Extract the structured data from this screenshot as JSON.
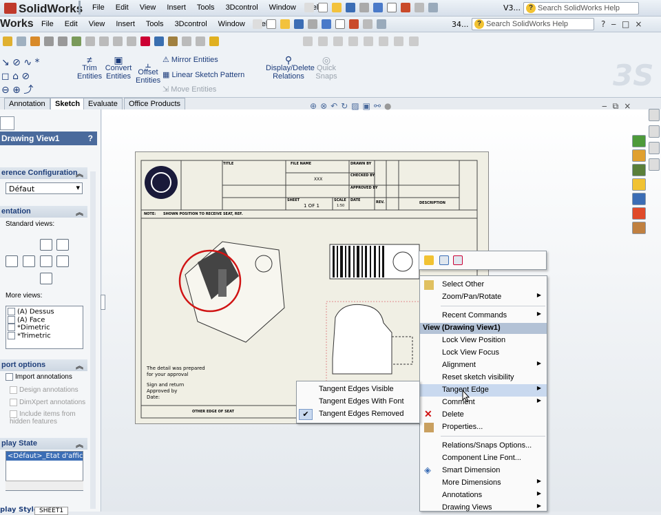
{
  "app": {
    "logo": "SolidWorks",
    "logo_inner": "Works",
    "version_label": "V3...",
    "version_label_inner": "34..."
  },
  "menu": [
    "File",
    "Edit",
    "View",
    "Insert",
    "Tools",
    "3Dcontrol",
    "Window",
    "Help"
  ],
  "search": {
    "placeholder": "Search SolidWorks Help"
  },
  "cmd": {
    "trim": "Trim\nEntities",
    "convert": "Convert\nEntities",
    "offset": "Offset\nEntities",
    "mirror": "Mirror Entities",
    "linear": "Linear Sketch Pattern",
    "move": "Move Entities",
    "display": "Display/Delete\nRelations",
    "quick": "Quick\nSnaps"
  },
  "tabs": [
    "Annotation",
    "Sketch",
    "Evaluate",
    "Office Products"
  ],
  "panel": {
    "title": "Drawing View1",
    "help": "?",
    "ref_config": "erence Configuration",
    "ref_value": "Défaut",
    "orientation": "entation",
    "standard_views": "Standard views:",
    "more_views": "More views:",
    "views": [
      "(A) Dessus",
      "(A) Face",
      "*Dimetric",
      "*Trimetric"
    ],
    "import_options": "port options",
    "import_annotations": "Import annotations",
    "design_annotations": "Design annotations",
    "dimxpert": "DimXpert annotations",
    "include_items": "Include items from\nhidden features",
    "display_state": "play State",
    "display_item": "<Défaut>_Etat d'afficha",
    "bottom_label": "play Style",
    "sheet_tab": "SHEET1"
  },
  "sheet": {
    "title": "TITLE",
    "file_name": "FILE NAME",
    "drawn_by": "DRAWN BY",
    "checked_by": "CHECKED BY",
    "approved_by": "APPROVED BY",
    "date": "DATE",
    "sheet": "SHEET",
    "sheet_value": "1 OF 1",
    "scale": "SCALE",
    "scale_value": "1:50",
    "rev": "REV.",
    "description": "DESCRIPTION",
    "note": "NOTE:",
    "note_text": "SHOWN POSITION TO RECEIVE SEAT, REF.",
    "detail1": "The detail was prepared",
    "detail2": "for your approval",
    "sign1": "Sign and return",
    "sign2": "Approved by",
    "sign3": "Date:",
    "footer": "OTHER EDGE OF SEAT",
    "xxx": "XXX"
  },
  "ctx": {
    "items": [
      {
        "label": "Select Other"
      },
      {
        "label": "Zoom/Pan/Rotate",
        "sub": true
      },
      {
        "label": "Recent Commands",
        "sub": true
      },
      {
        "label": "View (Drawing View1)",
        "head": true
      },
      {
        "label": "Lock View Position"
      },
      {
        "label": "Lock View Focus"
      },
      {
        "label": "Alignment",
        "sub": true
      },
      {
        "label": "Reset sketch visibility"
      },
      {
        "label": "Tangent Edge",
        "sub": true,
        "hl": true
      },
      {
        "label": "Comment",
        "sub": true
      },
      {
        "label": "Delete"
      },
      {
        "label": "Properties..."
      },
      {
        "label": "Relations/Snaps Options..."
      },
      {
        "label": "Component Line Font..."
      },
      {
        "label": "Smart Dimension"
      },
      {
        "label": "More Dimensions",
        "sub": true
      },
      {
        "label": "Annotations",
        "sub": true
      },
      {
        "label": "Drawing Views",
        "sub": true
      }
    ],
    "submenu": [
      "Tangent Edges Visible",
      "Tangent Edges With Font",
      "Tangent Edges Removed"
    ]
  }
}
